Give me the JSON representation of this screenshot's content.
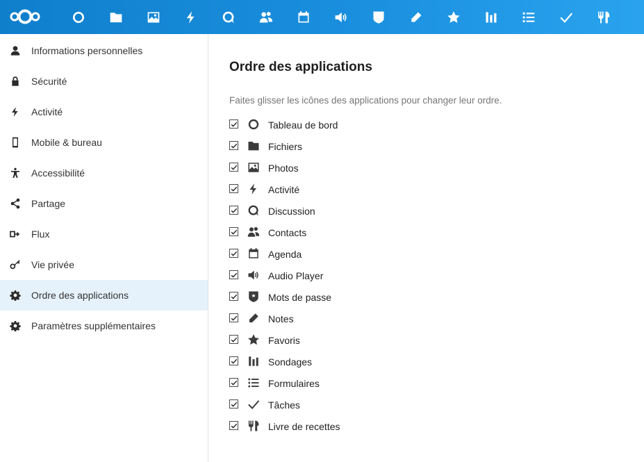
{
  "header": {
    "logo": "nextcloud-logo",
    "apps": [
      {
        "icon": "dashboard-icon"
      },
      {
        "icon": "files-icon"
      },
      {
        "icon": "photos-icon"
      },
      {
        "icon": "activity-icon"
      },
      {
        "icon": "talk-icon"
      },
      {
        "icon": "contacts-icon"
      },
      {
        "icon": "calendar-icon"
      },
      {
        "icon": "audio-player-icon"
      },
      {
        "icon": "passwords-icon"
      },
      {
        "icon": "notes-icon"
      },
      {
        "icon": "favorites-icon"
      },
      {
        "icon": "polls-icon"
      },
      {
        "icon": "forms-icon"
      },
      {
        "icon": "tasks-icon"
      },
      {
        "icon": "cookbook-icon"
      }
    ]
  },
  "sidebar": {
    "items": [
      {
        "label": "Informations personnelles",
        "icon": "user-icon"
      },
      {
        "label": "Sécurité",
        "icon": "lock-icon"
      },
      {
        "label": "Activité",
        "icon": "activity-icon"
      },
      {
        "label": "Mobile & bureau",
        "icon": "phone-icon"
      },
      {
        "label": "Accessibilité",
        "icon": "accessibility-icon"
      },
      {
        "label": "Partage",
        "icon": "share-icon"
      },
      {
        "label": "Flux",
        "icon": "flow-icon"
      },
      {
        "label": "Vie privée",
        "icon": "key-icon"
      },
      {
        "label": "Ordre des applications",
        "icon": "gear-icon",
        "active": true
      },
      {
        "label": "Paramètres supplémentaires",
        "icon": "gear-icon"
      }
    ]
  },
  "main": {
    "title": "Ordre des applications",
    "hint": "Faites glisser les icônes des applications pour changer leur ordre.",
    "apps": [
      {
        "label": "Tableau de bord",
        "icon": "dashboard-icon",
        "checked": true
      },
      {
        "label": "Fichiers",
        "icon": "files-icon",
        "checked": true
      },
      {
        "label": "Photos",
        "icon": "photos-icon",
        "checked": true
      },
      {
        "label": "Activité",
        "icon": "activity-icon",
        "checked": true
      },
      {
        "label": "Discussion",
        "icon": "talk-icon",
        "checked": true
      },
      {
        "label": "Contacts",
        "icon": "contacts-icon",
        "checked": true
      },
      {
        "label": "Agenda",
        "icon": "calendar-icon",
        "checked": true
      },
      {
        "label": "Audio Player",
        "icon": "audio-player-icon",
        "checked": true
      },
      {
        "label": "Mots de passe",
        "icon": "passwords-icon",
        "checked": true
      },
      {
        "label": "Notes",
        "icon": "notes-icon",
        "checked": true
      },
      {
        "label": "Favoris",
        "icon": "favorites-icon",
        "checked": true
      },
      {
        "label": "Sondages",
        "icon": "polls-icon",
        "checked": true
      },
      {
        "label": "Formulaires",
        "icon": "forms-icon",
        "checked": true
      },
      {
        "label": "Tâches",
        "icon": "tasks-icon",
        "checked": true
      },
      {
        "label": "Livre de recettes",
        "icon": "cookbook-icon",
        "checked": true
      }
    ]
  },
  "colors": {
    "header_start": "#0f7fcc",
    "header_end": "#2aa3ee",
    "active_item_bg": "#e6f2fb"
  }
}
